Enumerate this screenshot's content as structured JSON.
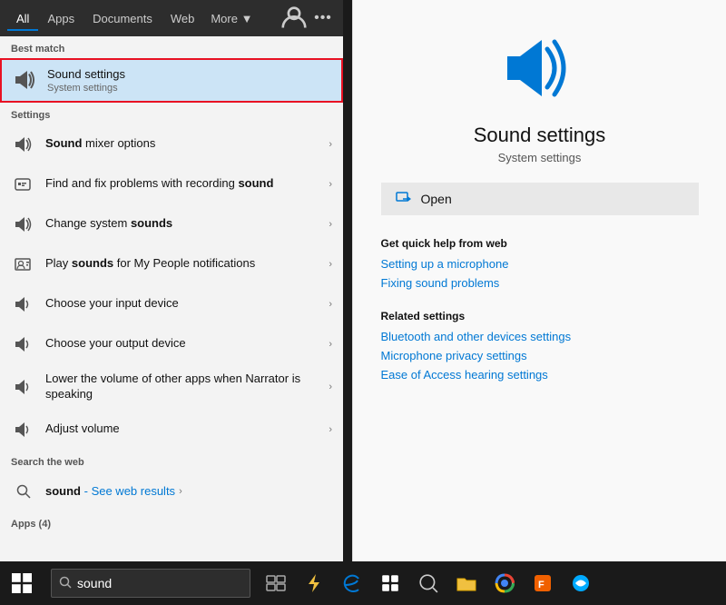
{
  "nav": {
    "tabs": [
      {
        "label": "All",
        "active": true
      },
      {
        "label": "Apps"
      },
      {
        "label": "Documents"
      },
      {
        "label": "Web"
      },
      {
        "label": "More ▼"
      }
    ]
  },
  "search": {
    "query": "sound",
    "placeholder": "sound"
  },
  "results": {
    "best_match_label": "Best match",
    "best_match": {
      "title": "Sound settings",
      "subtitle": "System settings"
    },
    "settings_label": "Settings",
    "settings_items": [
      {
        "title": "Sound mixer options",
        "bold": "Sound",
        "rest": " mixer options",
        "icon": "volume"
      },
      {
        "title": "Find and fix problems with recording sound",
        "bold": "sound",
        "rest_pre": "Find and fix problems with recording ",
        "icon": "record"
      },
      {
        "title": "Change system sounds",
        "bold": "sounds",
        "rest_pre": "Change system ",
        "icon": "volume"
      },
      {
        "title": "Play sounds for My People notifications",
        "bold": "sounds",
        "rest_pre": "Play ",
        "rest_post": " for My People notifications",
        "icon": "play"
      },
      {
        "title": "Choose your input device",
        "bold": "",
        "icon": "volume-small"
      },
      {
        "title": "Choose your output device",
        "bold": "",
        "icon": "volume-small"
      },
      {
        "title": "Lower the volume of other apps when Narrator is speaking",
        "bold": "",
        "icon": "volume-small"
      },
      {
        "title": "Adjust volume",
        "bold": "",
        "icon": "volume-small"
      }
    ],
    "web_label": "Search the web",
    "web_query": "sound",
    "web_see": "- See web results",
    "apps_label": "Apps (4)"
  },
  "right_panel": {
    "title": "Sound settings",
    "subtitle": "System settings",
    "open_label": "Open",
    "quick_help_title": "Get quick help from web",
    "quick_links": [
      "Setting up a microphone",
      "Fixing sound problems"
    ],
    "related_title": "Related settings",
    "related_links": [
      "Bluetooth and other devices settings",
      "Microphone privacy settings",
      "Ease of Access hearing settings"
    ]
  },
  "taskbar": {
    "search_placeholder": "sound",
    "search_value": "sound"
  }
}
